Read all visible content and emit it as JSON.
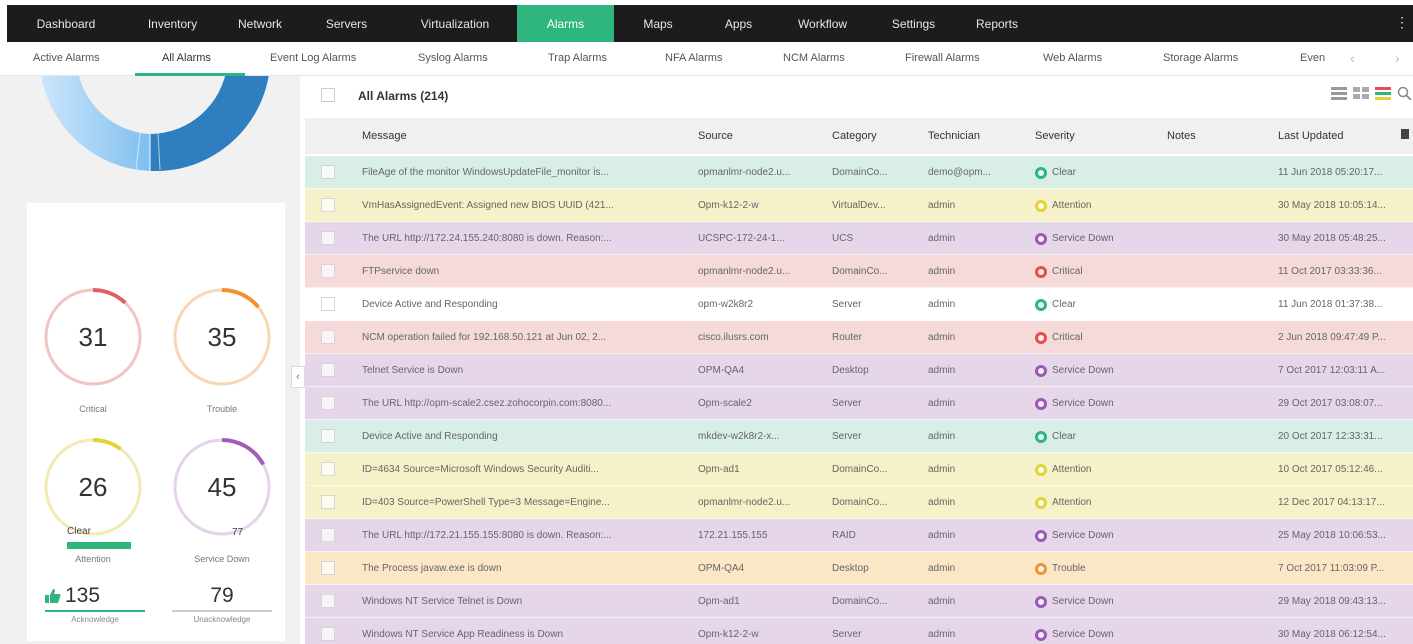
{
  "nav": {
    "items": [
      "Dashboard",
      "Inventory",
      "Network",
      "Servers",
      "Virtualization",
      "Alarms",
      "Maps",
      "Apps",
      "Workflow",
      "Settings",
      "Reports"
    ],
    "active": "Alarms",
    "accent": "#2fb57e"
  },
  "subtabs": {
    "items": [
      "Active Alarms",
      "All Alarms",
      "Event Log Alarms",
      "Syslog Alarms",
      "Trap Alarms",
      "NFA Alarms",
      "NCM Alarms",
      "Firewall Alarms",
      "Web Alarms",
      "Storage Alarms",
      "Even"
    ],
    "active": "All Alarms"
  },
  "summary": {
    "critical": {
      "value": "31",
      "label": "Critical",
      "color": "#e06060",
      "fraction": 0.12
    },
    "trouble": {
      "value": "35",
      "label": "Trouble",
      "color": "#f0922e",
      "fraction": 0.14
    },
    "attention": {
      "value": "26",
      "label": "Attention",
      "color": "#e3d23a",
      "fraction": 0.1
    },
    "service_down": {
      "value": "45",
      "label": "Service Down",
      "color": "#a05cb8",
      "fraction": 0.17
    },
    "clear": {
      "label": "Clear",
      "value": "77"
    },
    "acknowledged": {
      "value": "135",
      "label": "Acknowledge"
    },
    "unacknowledged": {
      "value": "79",
      "label": "Unacknowledge"
    }
  },
  "grid": {
    "title": "All Alarms (214)",
    "columns": [
      "Message",
      "Source",
      "Category",
      "Technician",
      "Severity",
      "Notes",
      "Last Updated"
    ],
    "rows": [
      {
        "message": "FileAge of the monitor WindowsUpdateFile_monitor is...",
        "source": "opmanlmr-node2.u...",
        "category": "DomainCo...",
        "technician": "demo@opm...",
        "severity": "Clear",
        "notes": "",
        "updated": "11 Jun 2018 05:20:17..."
      },
      {
        "message": "VmHasAssignedEvent: Assigned new BIOS UUID (421...",
        "source": "Opm-k12-2-w",
        "category": "VirtualDev...",
        "technician": "admin",
        "severity": "Attention",
        "notes": "",
        "updated": "30 May 2018 10:05:14..."
      },
      {
        "message": "The URL http://172.24.155.240:8080 is down. Reason:...",
        "source": "UCSPC-172-24-1...",
        "category": "UCS",
        "technician": "admin",
        "severity": "Service Down",
        "notes": "",
        "updated": "30 May 2018 05:48:25..."
      },
      {
        "message": "FTPservice down",
        "source": "opmanlmr-node2.u...",
        "category": "DomainCo...",
        "technician": "admin",
        "severity": "Critical",
        "notes": "",
        "updated": "11 Oct 2017 03:33:36..."
      },
      {
        "message": "Device Active and Responding",
        "source": "opm-w2k8r2",
        "category": "Server",
        "technician": "admin",
        "severity": "Clear",
        "notes": "",
        "updated": "11 Jun 2018 01:37:38..."
      },
      {
        "message": "NCM operation failed for 192.168.50.121 at Jun 02, 2...",
        "source": "cisco.ilusrs.com",
        "category": "Router",
        "technician": "admin",
        "severity": "Critical",
        "notes": "",
        "updated": "2 Jun 2018 09:47:49 P..."
      },
      {
        "message": "Telnet Service is Down",
        "source": "OPM-QA4",
        "category": "Desktop",
        "technician": "admin",
        "severity": "Service Down",
        "notes": "",
        "updated": "7 Oct 2017 12:03:11 A..."
      },
      {
        "message": "The URL http://opm-scale2.csez.zohocorpin.com:8080...",
        "source": "Opm-scale2",
        "category": "Server",
        "technician": "admin",
        "severity": "Service Down",
        "notes": "",
        "updated": "29 Oct 2017 03:08:07..."
      },
      {
        "message": "Device Active and Responding",
        "source": "mkdev-w2k8r2-x...",
        "category": "Server",
        "technician": "admin",
        "severity": "Clear",
        "notes": "",
        "updated": "20 Oct 2017 12:33:31..."
      },
      {
        "message": "ID=4634 Source=Microsoft Windows Security Auditi...",
        "source": "Opm-ad1",
        "category": "DomainCo...",
        "technician": "admin",
        "severity": "Attention",
        "notes": "",
        "updated": "10 Oct 2017 05:12:46..."
      },
      {
        "message": "ID=403 Source=PowerShell Type=3 Message=Engine...",
        "source": "opmanlmr-node2.u...",
        "category": "DomainCo...",
        "technician": "admin",
        "severity": "Attention",
        "notes": "",
        "updated": "12 Dec 2017 04:13:17..."
      },
      {
        "message": "The URL http://172.21.155.155:8080 is down. Reason:...",
        "source": "172.21.155.155",
        "category": "RAID",
        "technician": "admin",
        "severity": "Service Down",
        "notes": "",
        "updated": "25 May 2018 10:06:53..."
      },
      {
        "message": "The Process javaw.exe is down",
        "source": "OPM-QA4",
        "category": "Desktop",
        "technician": "admin",
        "severity": "Trouble",
        "notes": "",
        "updated": "7 Oct 2017 11:03:09 P..."
      },
      {
        "message": "Windows NT Service Telnet is Down",
        "source": "Opm-ad1",
        "category": "DomainCo...",
        "technician": "admin",
        "severity": "Service Down",
        "notes": "",
        "updated": "29 May 2018 09:43:13..."
      },
      {
        "message": "Windows NT Service App Readiness is Down",
        "source": "Opm-k12-2-w",
        "category": "Server",
        "technician": "admin",
        "severity": "Service Down",
        "notes": "",
        "updated": "30 May 2018 06:12:54..."
      }
    ]
  },
  "severity_colors": {
    "Clear": {
      "row": "#d8eee6",
      "dot": "#2fb57e"
    },
    "Attention": {
      "row": "#f5f1c8",
      "dot": "#e3d23a"
    },
    "Service Down": {
      "row": "#e5d6ea",
      "dot": "#9b59b6"
    },
    "Critical": {
      "row": "#f6d9d9",
      "dot": "#e05050"
    },
    "Trouble": {
      "row": "#fbe6c5",
      "dot": "#f0922e"
    },
    "ClearWhite": {
      "row": "#ffffff",
      "dot": "#2fb57e"
    }
  }
}
